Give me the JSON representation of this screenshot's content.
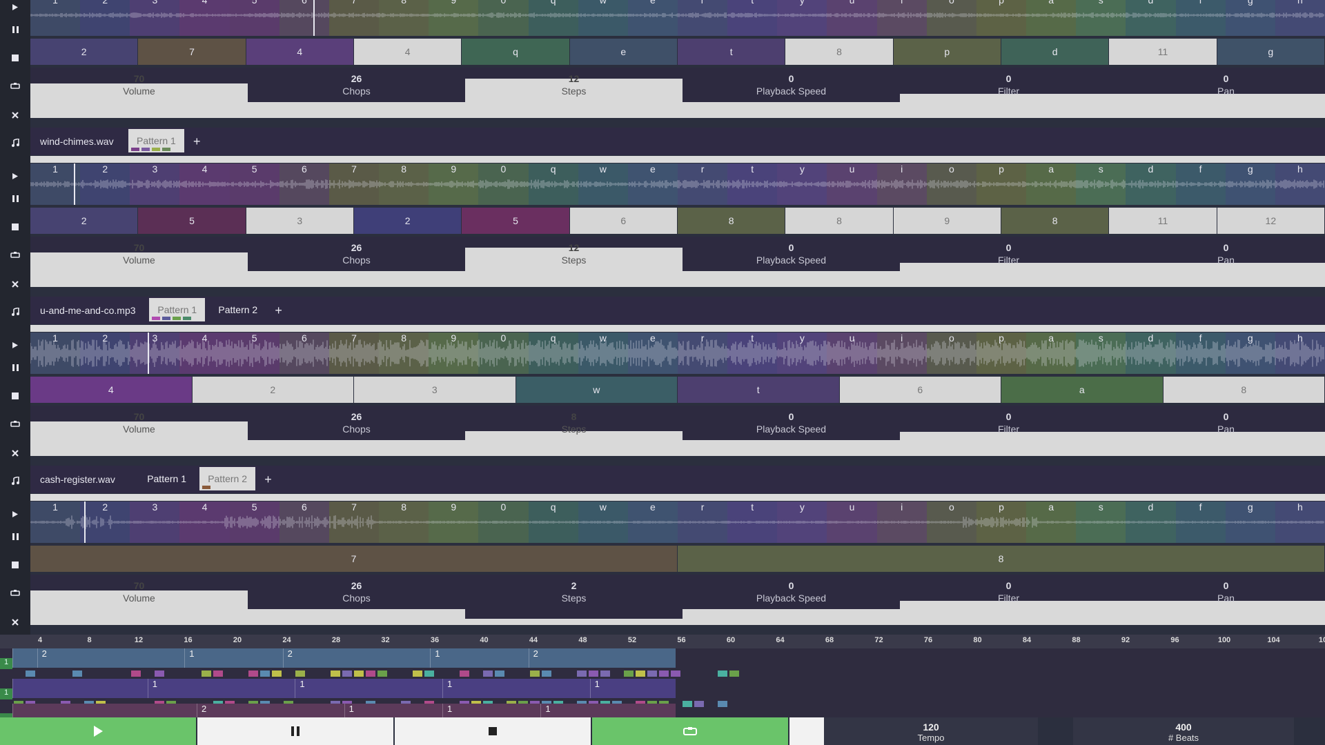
{
  "colors": {
    "accent_green": "#6ac46a",
    "key_palette": [
      "#3e4a66",
      "#3f4470",
      "#4e3f72",
      "#5b3a6f",
      "#5a3b6b",
      "#55485e",
      "#5a5a47",
      "#5b6148",
      "#566a4a",
      "#4a6450",
      "#3d5e5c",
      "#3b5968",
      "#3f5370",
      "#444a72",
      "#4a437a",
      "#52437a",
      "#5a426f",
      "#5b4a62",
      "#585a4e",
      "#5d6245",
      "#566a48",
      "#4b6d55",
      "#3f6360",
      "#3c5a6a",
      "#3f5272",
      "#444a74",
      "#4c457a"
    ]
  },
  "track_keys": [
    "1",
    "2",
    "3",
    "4",
    "5",
    "6",
    "7",
    "8",
    "9",
    "0",
    "q",
    "w",
    "e",
    "r",
    "t",
    "y",
    "u",
    "i",
    "o",
    "p",
    "a",
    "s",
    "d",
    "f",
    "g",
    "h"
  ],
  "sidebar_icon_names": [
    "play-icon",
    "pause-icon",
    "stop-icon",
    "loop-icon",
    "close-icon",
    "note-icon"
  ],
  "tracks": [
    {
      "file": "",
      "tabs": [],
      "steps": [
        {
          "label": "2",
          "color": "#474371",
          "light": false
        },
        {
          "label": "7",
          "color": "#5e5245",
          "light": false
        },
        {
          "label": "4",
          "color": "#5a3f7a",
          "light": false
        },
        {
          "label": "4",
          "color": "#d6d6d6",
          "light": true
        },
        {
          "label": "q",
          "color": "#3f6654",
          "light": false
        },
        {
          "label": "e",
          "color": "#3f5068",
          "light": false
        },
        {
          "label": "t",
          "color": "#4d3f6f",
          "light": false
        },
        {
          "label": "8",
          "color": "#d6d6d6",
          "light": true
        },
        {
          "label": "p",
          "color": "#5b6248",
          "light": false
        },
        {
          "label": "d",
          "color": "#3f6358",
          "light": false
        },
        {
          "label": "11",
          "color": "#d6d6d6",
          "light": true
        },
        {
          "label": "g",
          "color": "#3f5268",
          "light": false
        }
      ],
      "params": [
        {
          "value": "70",
          "label": "Volume",
          "fill": 0.68
        },
        {
          "value": "26",
          "label": "Chops",
          "fill": 0.32
        },
        {
          "value": "12",
          "label": "Steps",
          "fill": 0.78
        },
        {
          "value": "0",
          "label": "Playback Speed",
          "fill": 0.32
        },
        {
          "value": "0",
          "label": "Filter",
          "fill": 0.48
        },
        {
          "value": "0",
          "label": "Pan",
          "fill": 0.48
        }
      ]
    },
    {
      "file": "wind-chimes.wav",
      "tabs": [
        {
          "label": "Pattern 1",
          "active": true,
          "swatches": [
            "#7a3f8a",
            "#7a5aa0",
            "#9ab04a",
            "#6a8a5a"
          ]
        }
      ],
      "steps": [
        {
          "label": "2",
          "color": "#474371",
          "light": false
        },
        {
          "label": "5",
          "color": "#5b2f55",
          "light": false
        },
        {
          "label": "3",
          "color": "#d6d6d6",
          "light": true
        },
        {
          "label": "2",
          "color": "#3f3f78",
          "light": false
        },
        {
          "label": "5",
          "color": "#6a2f60",
          "light": false
        },
        {
          "label": "6",
          "color": "#d6d6d6",
          "light": true
        },
        {
          "label": "8",
          "color": "#5b6248",
          "light": false
        },
        {
          "label": "8",
          "color": "#d6d6d6",
          "light": true
        },
        {
          "label": "9",
          "color": "#d6d6d6",
          "light": true
        },
        {
          "label": "8",
          "color": "#5b6248",
          "light": false
        },
        {
          "label": "11",
          "color": "#d6d6d6",
          "light": true
        },
        {
          "label": "12",
          "color": "#d6d6d6",
          "light": true
        }
      ],
      "params": [
        {
          "value": "70",
          "label": "Volume",
          "fill": 0.68
        },
        {
          "value": "26",
          "label": "Chops",
          "fill": 0.32
        },
        {
          "value": "12",
          "label": "Steps",
          "fill": 0.78
        },
        {
          "value": "0",
          "label": "Playback Speed",
          "fill": 0.32
        },
        {
          "value": "0",
          "label": "Filter",
          "fill": 0.48
        },
        {
          "value": "0",
          "label": "Pan",
          "fill": 0.48
        }
      ]
    },
    {
      "file": "u-and-me-and-co.mp3",
      "tabs": [
        {
          "label": "Pattern 1",
          "active": true,
          "swatches": [
            "#b04ab0",
            "#5a5a9a",
            "#6aa04a",
            "#4a8a6a"
          ]
        },
        {
          "label": "Pattern 2",
          "active": false,
          "swatches": []
        }
      ],
      "steps": [
        {
          "label": "4",
          "color": "#6a3a86",
          "light": false
        },
        {
          "label": "2",
          "color": "#d6d6d6",
          "light": true
        },
        {
          "label": "3",
          "color": "#d6d6d6",
          "light": true
        },
        {
          "label": "w",
          "color": "#3b5e66",
          "light": false
        },
        {
          "label": "t",
          "color": "#4d3f6f",
          "light": false
        },
        {
          "label": "6",
          "color": "#d6d6d6",
          "light": true
        },
        {
          "label": "a",
          "color": "#4b6d48",
          "light": false
        },
        {
          "label": "8",
          "color": "#d6d6d6",
          "light": true
        }
      ],
      "params": [
        {
          "value": "70",
          "label": "Volume",
          "fill": 0.68
        },
        {
          "value": "26",
          "label": "Chops",
          "fill": 0.32
        },
        {
          "value": "8",
          "label": "Steps",
          "fill": 0.5
        },
        {
          "value": "0",
          "label": "Playback Speed",
          "fill": 0.32
        },
        {
          "value": "0",
          "label": "Filter",
          "fill": 0.48
        },
        {
          "value": "0",
          "label": "Pan",
          "fill": 0.48
        }
      ]
    },
    {
      "file": "cash-register.wav",
      "tabs": [
        {
          "label": "Pattern 1",
          "active": false,
          "swatches": []
        },
        {
          "label": "Pattern 2",
          "active": true,
          "swatches": [
            "#8a5a3a"
          ]
        }
      ],
      "steps": [
        {
          "label": "7",
          "color": "#5e5245",
          "light": false
        },
        {
          "label": "8",
          "color": "#5b6248",
          "light": false
        }
      ],
      "params": [
        {
          "value": "70",
          "label": "Volume",
          "fill": 0.68
        },
        {
          "value": "26",
          "label": "Chops",
          "fill": 0.32
        },
        {
          "value": "2",
          "label": "Steps",
          "fill": 0.12
        },
        {
          "value": "0",
          "label": "Playback Speed",
          "fill": 0.32
        },
        {
          "value": "0",
          "label": "Filter",
          "fill": 0.48
        },
        {
          "value": "0",
          "label": "Pan",
          "fill": 0.48
        }
      ]
    }
  ],
  "arranger": {
    "ruler": [
      "4",
      "8",
      "12",
      "16",
      "20",
      "24",
      "28",
      "32",
      "36",
      "40",
      "44",
      "48",
      "52",
      "56",
      "60",
      "64",
      "68",
      "72",
      "76",
      "80",
      "84",
      "88",
      "92",
      "96",
      "100",
      "104",
      "10"
    ],
    "lanes": [
      {
        "label": "1",
        "blocks": [
          {
            "label": "",
            "start": 0,
            "len": 2
          },
          {
            "label": "2",
            "start": 2,
            "len": 12
          },
          {
            "label": "1",
            "start": 14,
            "len": 8
          },
          {
            "label": "2",
            "start": 22,
            "len": 12
          },
          {
            "label": "1",
            "start": 34,
            "len": 8
          },
          {
            "label": "2",
            "start": 42,
            "len": 12
          }
        ],
        "color": "#4a6788"
      },
      {
        "label": "1",
        "blocks": [
          {
            "label": "",
            "start": 0,
            "len": 11
          },
          {
            "label": "1",
            "start": 11,
            "len": 12
          },
          {
            "label": "1",
            "start": 23,
            "len": 12
          },
          {
            "label": "1",
            "start": 35,
            "len": 12
          },
          {
            "label": "1",
            "start": 47,
            "len": 7
          }
        ],
        "color": "#4a3f82"
      },
      {
        "label": "",
        "blocks": [
          {
            "label": "",
            "start": 0,
            "len": 15
          },
          {
            "label": "2",
            "start": 15,
            "len": 12
          },
          {
            "label": "1",
            "start": 27,
            "len": 8
          },
          {
            "label": "1",
            "start": 35,
            "len": 8
          },
          {
            "label": "1",
            "start": 43,
            "len": 11
          }
        ],
        "color": "#5c3a5a"
      }
    ]
  },
  "transport": {
    "tempo_value": "120",
    "tempo_label": "Tempo",
    "beats_value": "400",
    "beats_label": "# Beats"
  }
}
